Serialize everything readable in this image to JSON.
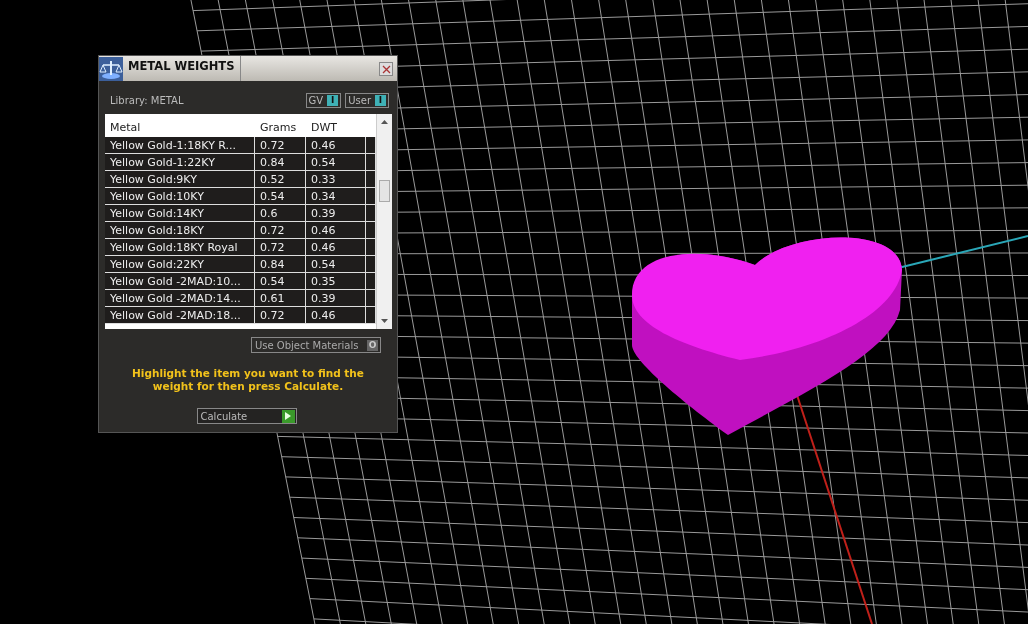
{
  "dialog": {
    "title": "METAL WEIGHTS",
    "library_label": "Library: METAL",
    "toggles": [
      {
        "label": "GV",
        "glyph": "I",
        "on": true
      },
      {
        "label": "User",
        "glyph": "I",
        "on": true
      }
    ],
    "table": {
      "columns": [
        "Metal",
        "Grams",
        "DWT"
      ],
      "rows": [
        {
          "cells": [
            "Yellow Gold-1:18KY R...",
            "0.72",
            "0.46"
          ],
          "selected": false
        },
        {
          "cells": [
            "Yellow Gold-1:22KY",
            "0.84",
            "0.54"
          ],
          "selected": false
        },
        {
          "cells": [
            "Yellow Gold:9KY",
            "0.52",
            "0.33"
          ],
          "selected": false
        },
        {
          "cells": [
            "Yellow Gold:10KY",
            "0.54",
            "0.34"
          ],
          "selected": false
        },
        {
          "cells": [
            "Yellow Gold:14KY",
            "0.6",
            "0.39"
          ],
          "selected": false
        },
        {
          "cells": [
            "Yellow Gold:18KY",
            "0.72",
            "0.46"
          ],
          "selected": false
        },
        {
          "cells": [
            "Yellow Gold:18KY Royal",
            "0.72",
            "0.46"
          ],
          "selected": false
        },
        {
          "cells": [
            "Yellow Gold:22KY",
            "0.84",
            "0.54"
          ],
          "selected": false
        },
        {
          "cells": [
            "Yellow Gold -2MAD:10...",
            "0.54",
            "0.35"
          ],
          "selected": false
        },
        {
          "cells": [
            "Yellow Gold -2MAD:14...",
            "0.61",
            "0.39"
          ],
          "selected": false
        },
        {
          "cells": [
            "Yellow Gold -2MAD:18...",
            "0.72",
            "0.46"
          ],
          "selected": false
        }
      ]
    },
    "object_materials": {
      "label": "Use Object Materials",
      "glyph": "O",
      "on": false
    },
    "instruction": "Highlight the item you want to find the weight for then press Calculate.",
    "calculate_button": "Calculate"
  }
}
